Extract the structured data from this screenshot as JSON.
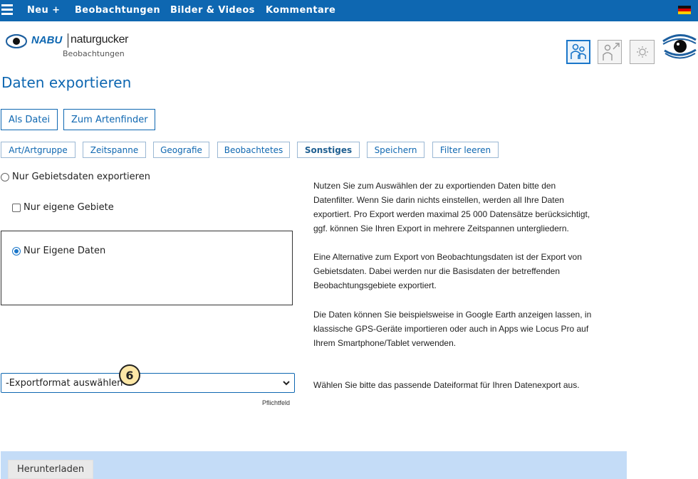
{
  "nav": {
    "items": [
      "Neu +",
      "Beobachtungen",
      "Bilder & Videos",
      "Kommentare"
    ],
    "menu_icon": "hamburger-menu-icon",
    "language_icon": "german-flag-icon"
  },
  "logo": {
    "brand": "NABU",
    "name": "naturgucker",
    "subtitle": "Beobachtungen"
  },
  "header_icons": [
    "people-icon",
    "person-arrow-icon",
    "sun-settings-icon",
    "naturgucker-eye-logo"
  ],
  "page_title": "Daten exportieren",
  "mode_buttons": [
    "Als Datei",
    "Zum Artenfinder"
  ],
  "filter_tabs": [
    "Art/Artgruppe",
    "Zeitspanne",
    "Geografie",
    "Beobachtetes",
    "Sonstiges",
    "Speichern",
    "Filter leeren"
  ],
  "active_tab": "Sonstiges",
  "options": {
    "gebiet_radio": "Nur Gebietsdaten exportieren",
    "eigene_gebiete_checkbox": "Nur eigene Gebiete",
    "eigene_daten_radio": "Nur Eigene Daten"
  },
  "help": {
    "p1": [
      "Nutzen Sie zum Auswählen der zu exportienden Daten bitte den",
      "Datenfilter. Wenn Sie darin nichts einstellen, werden all Ihre Daten",
      "exportiert. Pro Export werden maximal 25 000 Datensätze berücksichtigt,",
      "ggf. können Sie Ihren Export in mehrere Zeitspannen untergliedern."
    ],
    "p2": [
      "Eine Alternative zum Export von Beobachtungsdaten ist der Export von",
      "Gebietsdaten. Dabei werden nur die Basisdaten der betreffenden",
      "Beobachtungsgebiete exportiert."
    ],
    "p3": [
      "Die Daten können Sie beispielsweise in Google Earth anzeigen lassen, in",
      "klassische GPS-Geräte importieren oder auch in Apps wie Locus Pro auf",
      "Ihrem Smartphone/Tablet verwenden."
    ],
    "format_hint": "Wählen Sie bitte das passende Dateiformat für Ihren Datenexport aus."
  },
  "format_select": {
    "value": "-Exportformat auswählen-",
    "required_label": "Pflichtfeld"
  },
  "step_badge": "6",
  "download_button": "Herunterladen",
  "colors": {
    "nav_bg": "#0e67b1",
    "accent": "#0e67b1",
    "footer_bg": "#c4dcf7",
    "badge_bg": "#fde7a6"
  }
}
